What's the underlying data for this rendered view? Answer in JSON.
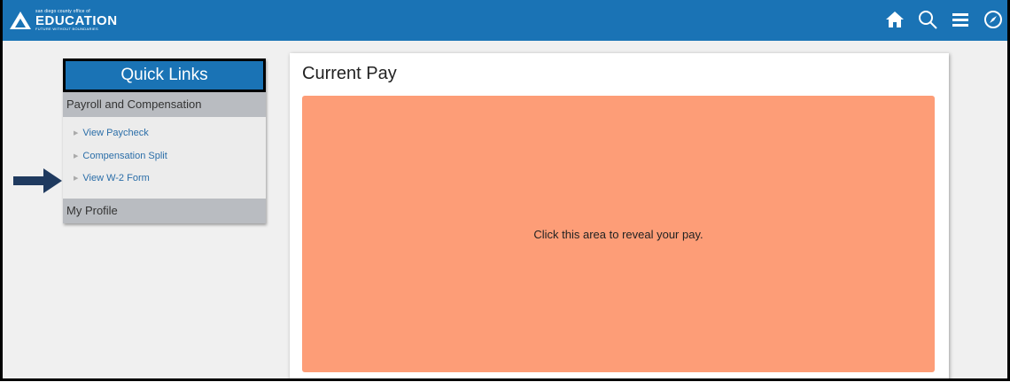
{
  "header": {
    "logo": {
      "top_line": "san diego county office of",
      "name": "EDUCATION",
      "tagline": "FUTURE WITHOUT BOUNDARIES"
    },
    "icons": [
      "home-icon",
      "search-icon",
      "menu-icon",
      "compass-icon"
    ],
    "color": "#1a73b5"
  },
  "quick_links": {
    "title": "Quick Links",
    "sections": [
      {
        "label": "Payroll and Compensation",
        "items": [
          "View Paycheck",
          "Compensation Split",
          "View W-2 Form"
        ]
      },
      {
        "label": "My Profile",
        "items": []
      }
    ]
  },
  "main": {
    "title": "Current Pay",
    "reveal_text": "Click this area to reveal your pay.",
    "reveal_color": "#fd9d77"
  },
  "annotation": {
    "arrow_target": "View W-2 Form",
    "arrow_color": "#1f3a5f"
  }
}
